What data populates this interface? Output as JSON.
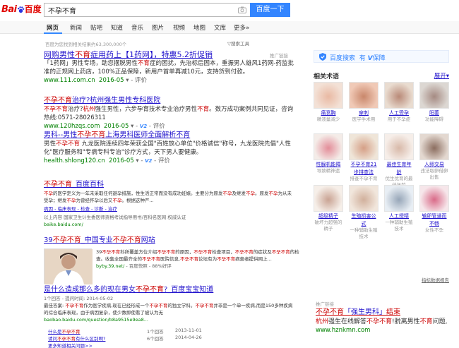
{
  "logo": {
    "left": "Bai",
    "right": "百度"
  },
  "search": {
    "query": "不孕不育",
    "button_label": "百度一下"
  },
  "tabs": [
    "网页",
    "新闻",
    "贴吧",
    "知道",
    "音乐",
    "图片",
    "视频",
    "地图",
    "文库",
    "更多»"
  ],
  "result_count": "百度为您找到相关结果约63,300,000个",
  "search_tools": "搜索工具",
  "ad_label": "推广链接",
  "results": [
    {
      "title_a": "网购男性",
      "title_b": "不育",
      "title_c": "症用药上【1药网】，特惠5.2折促销",
      "desc_a": "「1药网」男性专场，助您摆脱男性",
      "desc_b": "不育",
      "desc_c": "症的困扰，先治标后固本，重振男人雄风1药网-药监批准的正规网上药店，100%正品保障，新用户首单再减10元，支持货到付款。",
      "url": "www.111.com.cn",
      "date": "2016-05",
      "rating": "评价"
    },
    {
      "title_a": "不孕不育",
      "title_b": "治疗?杭州强生男性专科医院",
      "desc_a": "不孕不育",
      "desc_b": "治疗?",
      "desc_c": "杭州",
      "desc_d": "强生男性，六步孕育技术专业治疗男性",
      "desc_e": "不育",
      "desc_f": "。数万成功案例共同见证，咨询热线:0571-28026311",
      "url": "www.120hzqs.com",
      "date": "2016-05",
      "v": "V2",
      "rating": "评价"
    },
    {
      "title_a": "男科--男性",
      "title_b": "不孕不育",
      "title_c": "上海男科医师全面解析不育",
      "desc_a": "男性",
      "desc_b": "不孕不育",
      "desc_c": " 九龙医院连续四年荣获全国\"百姓放心单位\"价格诚信\"称号，九龙医院先倡\"人性化\"医疗服务和\"专病专科专治\"诊疗方式，天下男人要健康。",
      "url": "health.shlong120.cn",
      "date": "2016-05",
      "v": "V2",
      "rating": "评价"
    },
    {
      "title_a": "不孕不育",
      "title_b": "_百度百科",
      "desc_a": "不孕",
      "desc_b": "的医学定义为一年未采取任何避孕措施，性生活正常而没有成功妊娠。主要分为原发",
      "desc_c": "不孕",
      "desc_d": "及继发",
      "desc_e": "不孕",
      "desc_f": "。原发",
      "desc_g": "不孕",
      "desc_h": "为从未受孕；继发",
      "desc_i": "不孕",
      "desc_j": "为曾经怀孕以后又",
      "desc_k": "不孕",
      "desc_l": "。根据这种严...",
      "links": "病因 - 临床表现 - 检查 - 诊断 - 治疗",
      "source": "以上内容 国家卫生计生委医师资格考试指导用书/百科名医网 权威认证",
      "url": "baike.baidu.com/"
    },
    {
      "title_a": "39",
      "title_b": "不孕不育",
      "title_c": "_中国专业",
      "title_d": "不孕不育",
      "title_e": "网站",
      "desc_a": "39",
      "desc_b": "不孕不育",
      "desc_c": "科所覆盖方位介绍",
      "desc_d": "不孕不育",
      "desc_e": "的原因，",
      "desc_f": "不孕不育",
      "desc_g": "检查项目，",
      "desc_h": "不孕不育",
      "desc_i": "的症状及",
      "desc_j": "不孕不育",
      "desc_k": "的检查。收集全国最齐全的",
      "desc_l": "不孕不育",
      "desc_m": "医院信息,",
      "desc_n": "不孕不育",
      "desc_o": "论坛有为",
      "desc_p": "不孕不育",
      "desc_q": "病患者提供网上...",
      "url": "byby.39.net/",
      "extra": "- 百度快照 - 88%好评"
    },
    {
      "title_a": "是什么造成那么多的现在男女",
      "title_b": "不孕不育",
      "title_c": "?_百度宝宝知道",
      "meta": "1个回答 - 提问时间: 2014-05-02",
      "desc_a": "最佳答案: ",
      "desc_b": "不孕不育",
      "desc_c": "作为医学疾病,现在已经形成一个",
      "desc_d": "不孕不育",
      "desc_e": "的独立学科。",
      "desc_f": "不孕不育",
      "desc_g": "并非是一个单一疾病,而是150多种疾病的综合临床表现，由于病因复杂，使少数即使看了被认为无",
      "url": "baobao.baidu.com/question/b8a9515e9ea8...",
      "qa": [
        {
          "q_a": "什么是",
          "q_b": "不孕不育",
          "a": "1个回答",
          "d": "2013-11-01"
        },
        {
          "q_a": "请问",
          "q_b": "不孕不育",
          "q_c": "有什么区别啊?",
          "a": "6个回答",
          "d": "2014-04-26"
        },
        {
          "q_a": "更多知道相关问题>>"
        }
      ]
    }
  ],
  "right": {
    "protect_a": "百度搜索",
    "protect_b": "有",
    "protect_c": "保障",
    "related_title": "相关术语",
    "expand": "展开",
    "tiles": [
      {
        "name": "痛衰胸",
        "sub": "精液量减少"
      },
      {
        "name": "穿刺",
        "sub": "医学手术用"
      },
      {
        "name": "人工受孕",
        "sub": "用于不孕症"
      },
      {
        "name": "阳萎",
        "sub": "功能障碍"
      },
      {
        "name": "性腺机能障",
        "sub": "导致精神遗"
      },
      {
        "name": "不孕不育21",
        "sub": "步排查法",
        "sub2": "排查不孕不育"
      },
      {
        "name": "最佳生育年",
        "sub": "龄",
        "sub2": "优生优育的最佳年龄"
      },
      {
        "name": "人卵交易",
        "sub": "违法取卵借卵出售"
      },
      {
        "name": "超级精子",
        "sub": "破坏力超强的精子"
      },
      {
        "name": "生殖损害公",
        "sub": "式",
        "sub2": "一种辅助生殖技术"
      },
      {
        "name": "人工授精",
        "sub": "一种辅助生殖技术"
      },
      {
        "name": "输卵管通而",
        "sub": "不畅",
        "sub2": "女性不孕"
      }
    ],
    "more": "指标数据报告"
  },
  "side_ad": {
    "title_a": "不孕不育",
    "title_b": "「强生男科」",
    "title_c": "结束",
    "desc_a": "杭州",
    "desc_b": "强生在线解答",
    "desc_c": "不孕不育",
    "desc_d": "!脱离男性",
    "desc_e": "不育",
    "desc_f": "问题,",
    "url": "www.hznkmn.com"
  },
  "colors": {
    "link": "#2012cc",
    "em": "#cc0000",
    "url": "#008000",
    "accent": "#3385ff"
  }
}
